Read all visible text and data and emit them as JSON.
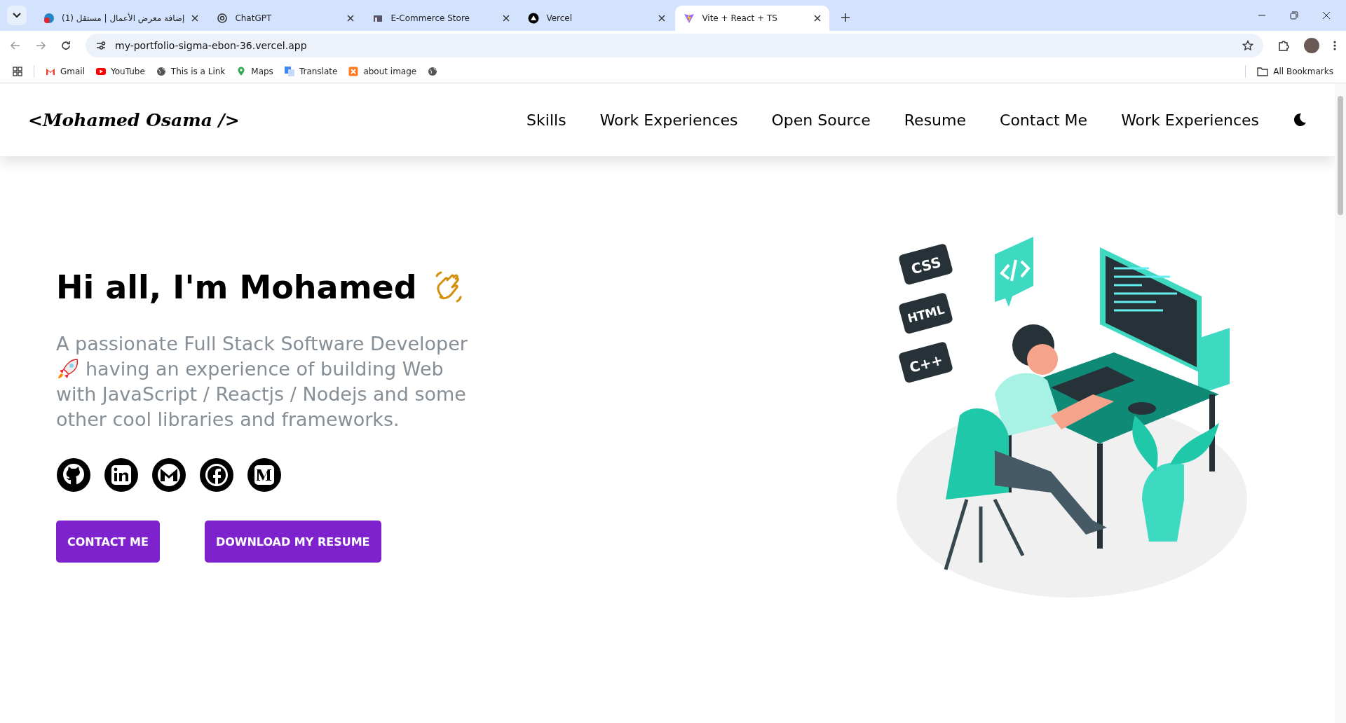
{
  "browser": {
    "tabs": [
      {
        "title": "(1) إضافة معرض الأعمال | مستقل",
        "selected": false
      },
      {
        "title": "ChatGPT",
        "selected": false
      },
      {
        "title": "E-Commerce Store",
        "selected": false
      },
      {
        "title": "Vercel",
        "selected": false
      },
      {
        "title": "Vite + React + TS",
        "selected": true
      }
    ],
    "url": "my-portfolio-sigma-ebon-36.vercel.app",
    "bookmarks": [
      {
        "label": "Gmail"
      },
      {
        "label": "YouTube"
      },
      {
        "label": "This is a Link"
      },
      {
        "label": "Maps"
      },
      {
        "label": "Translate"
      },
      {
        "label": "about image"
      }
    ],
    "all_bookmarks": "All Bookmarks"
  },
  "site": {
    "logo": "<Mohamed Osama />",
    "nav": [
      "Skills",
      "Work Experiences",
      "Open Source",
      "Resume",
      "Contact Me",
      "Work Experiences"
    ],
    "greeting": "Hi all, I'm Mohamed",
    "intro_before": "A passionate Full Stack Software Developer",
    "intro_line2": "having an experience of building Web",
    "intro_rest": "with JavaScript / Reactjs / Nodejs and some other cool libraries and frameworks.",
    "illustration_badges": [
      "CSS",
      "HTML",
      "C++"
    ],
    "buttons": [
      "CONTACT ME",
      "DOWNLOAD MY RESUME"
    ]
  }
}
